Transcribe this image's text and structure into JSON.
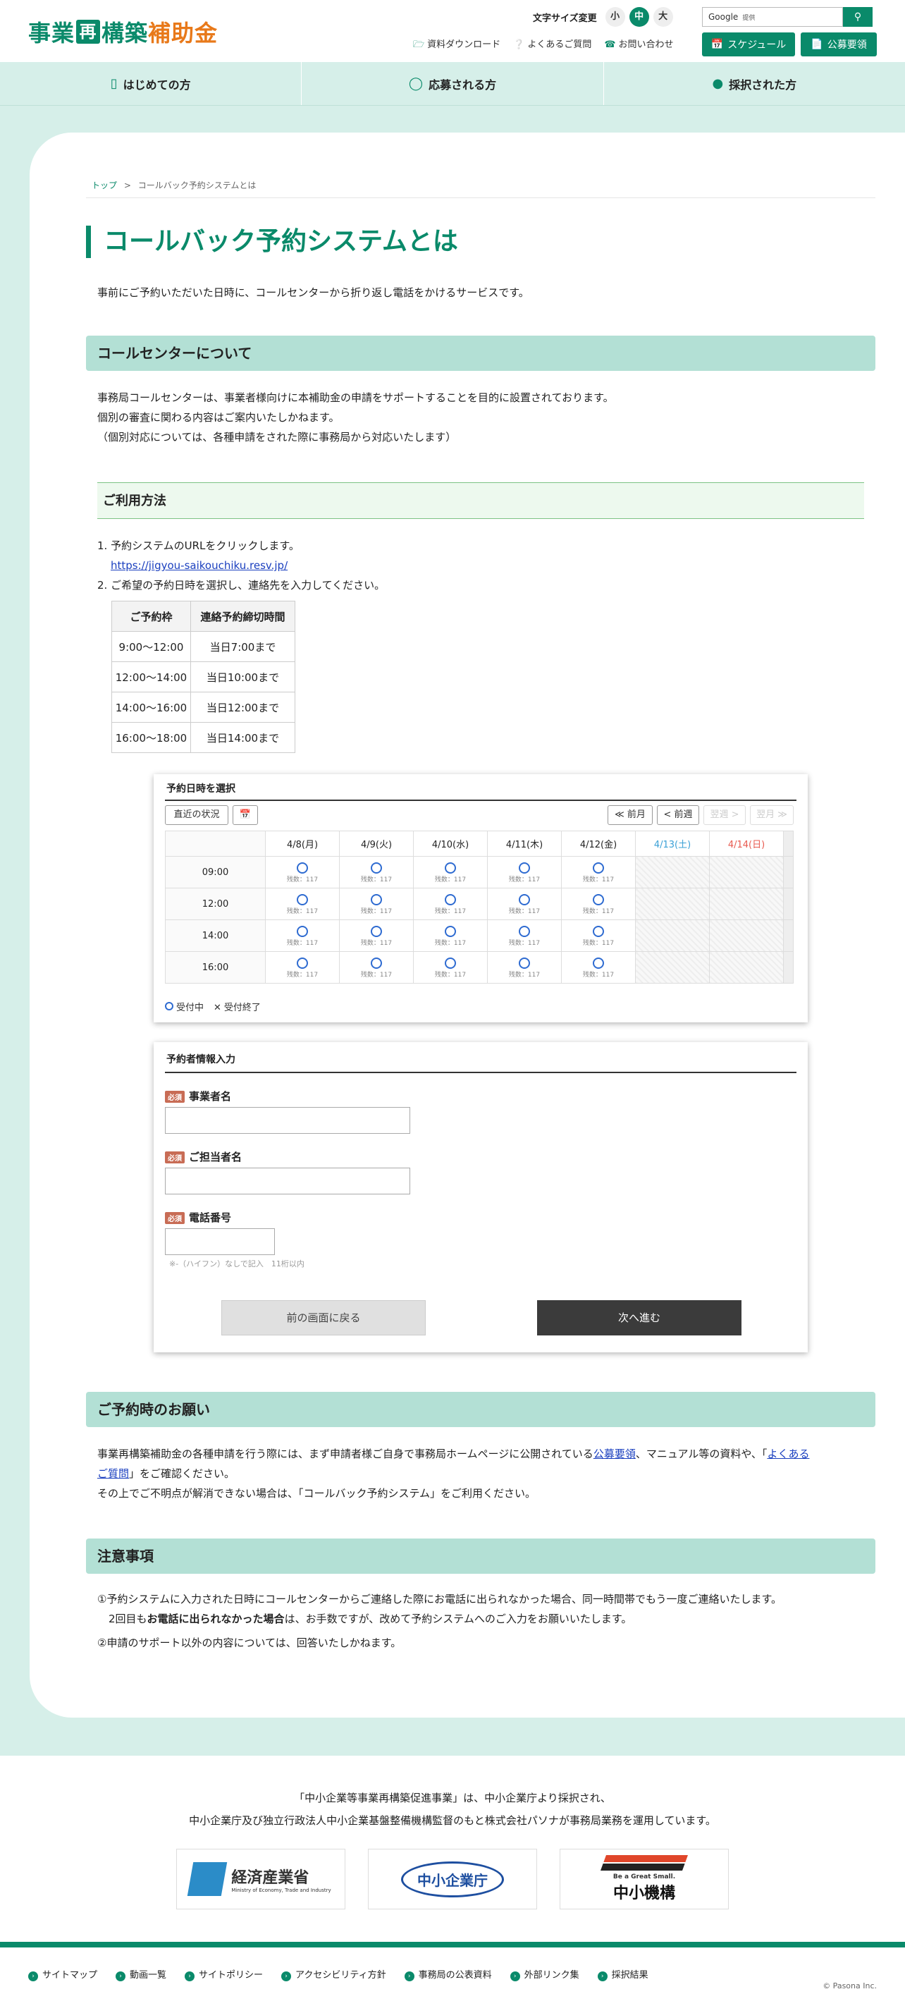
{
  "header": {
    "logo": {
      "part1": "事業",
      "box": "再",
      "part2": "構築",
      "part3": "補助金"
    },
    "font_size": {
      "label": "文字サイズ変更",
      "small": "小",
      "medium": "中",
      "large": "大"
    },
    "search": {
      "brand": "Google",
      "placeholder": "提供",
      "button_icon": "search-icon"
    },
    "links": [
      "資料ダウンロード",
      "よくあるご質問",
      "お問い合わせ"
    ],
    "buttons": {
      "schedule": "スケジュール",
      "guidelines": "公募要領"
    }
  },
  "nav": [
    "はじめての方",
    "応募される方",
    "採択された方"
  ],
  "breadcrumb": {
    "home": "トップ",
    "sep": ">",
    "current": "コールバック予約システムとは"
  },
  "page": {
    "title": "コールバック予約システムとは",
    "lead": "事前にご予約いただいた日時に、コールセンターから折り返し電話をかけるサービスです。"
  },
  "call_center": {
    "heading": "コールセンターについて",
    "lines": [
      "事務局コールセンターは、事業者様向けに本補助金の申請をサポートすることを目的に設置されております。",
      "個別の審査に関わる内容はご案内いたしかねます。",
      "（個別対応については、各種申請をされた際に事務局から対応いたします）"
    ]
  },
  "usage": {
    "heading": "ご利用方法",
    "step1": "1. 予約システムのURLをクリックします。",
    "url": "https://jigyou-saikouchiku.resv.jp/",
    "step2": "2. ご希望の予約日時を選択し、連絡先を入力してください。",
    "table": {
      "headers": [
        "ご予約枠",
        "連絡予約締切時間"
      ],
      "rows": [
        [
          "9:00〜12:00",
          "当日7:00まで"
        ],
        [
          "12:00〜14:00",
          "当日10:00まで"
        ],
        [
          "14:00〜16:00",
          "当日12:00まで"
        ],
        [
          "16:00〜18:00",
          "当日14:00まで"
        ]
      ]
    }
  },
  "calendar_mock": {
    "title": "予約日時を選択",
    "status_btn": "直近の状況",
    "nav": {
      "prev_month": "≪ 前月",
      "prev_week": "< 前週",
      "next_week": "翌週 >",
      "next_month": "翌月 ≫"
    },
    "days": [
      "4/8(月)",
      "4/9(火)",
      "4/10(水)",
      "4/11(木)",
      "4/12(金)",
      "4/13(土)",
      "4/14(日)"
    ],
    "times": [
      "09:00",
      "12:00",
      "14:00",
      "16:00"
    ],
    "remaining": "残数：117",
    "legend": {
      "open": "受付中",
      "closed": "受付終了"
    }
  },
  "form_mock": {
    "title": "予約者情報入力",
    "required": "必須",
    "fields": [
      "事業者名",
      "ご担当者名",
      "電話番号"
    ],
    "phone_note": "※-（ハイフン）なしで記入　11桁以内",
    "back": "前の画面に戻る",
    "next": "次へ進む"
  },
  "request": {
    "heading": "ご予約時のお願い",
    "line1a": "事業再構築補助金の各種申請を行う際には、まず申請者様ご自身で事務局ホームページに公開されている",
    "link1": "公募要領",
    "line1b": "、マニュアル等の資料や、「",
    "link2a": "よくある",
    "link2b": "ご質問",
    "line1c": "」をご確認ください。",
    "line2": "その上でご不明点が解消できない場合は、「コールバック予約システム」をご利用ください。"
  },
  "notes": {
    "heading": "注意事項",
    "n1": "①予約システムに入力された日時にコールセンターからご連絡した際にお電話に出られなかった場合、同一時間帯でもう一度ご連絡いたします。",
    "n1b_pre": "2回目も",
    "n1b_bold": "お電話に出られなかった場合",
    "n1b_post": "は、お手数ですが、改めて予約システムへのご入力をお願いいたします。",
    "n2": "②申請のサポート以外の内容については、回答いたしかねます。"
  },
  "footer": {
    "line1": "「中小企業等事業再構築促進事業」は、中小企業庁より採択され、",
    "line2": "中小企業庁及び独立行政法人中小企業基盤整備機構監督のもと株式会社パソナが事務局業務を運用しています。",
    "logos": {
      "meti": "経済産業省",
      "meti_en": "Ministry of Economy, Trade and Industry",
      "sme": "中小企業庁",
      "smrj_tag": "Be a Great Small.",
      "smrj": "中小機構"
    },
    "nav": [
      "サイトマップ",
      "動画一覧",
      "サイトポリシー",
      "アクセシビリティ方針",
      "事務局の公表資料",
      "外部リンク集",
      "採択結果"
    ],
    "copyright": "© Pasona Inc."
  },
  "colors": {
    "brand": "#0a8a6a",
    "accent": "#e8791a",
    "section_bg": "#b3e0d5",
    "band_bg": "#d6efe9"
  }
}
